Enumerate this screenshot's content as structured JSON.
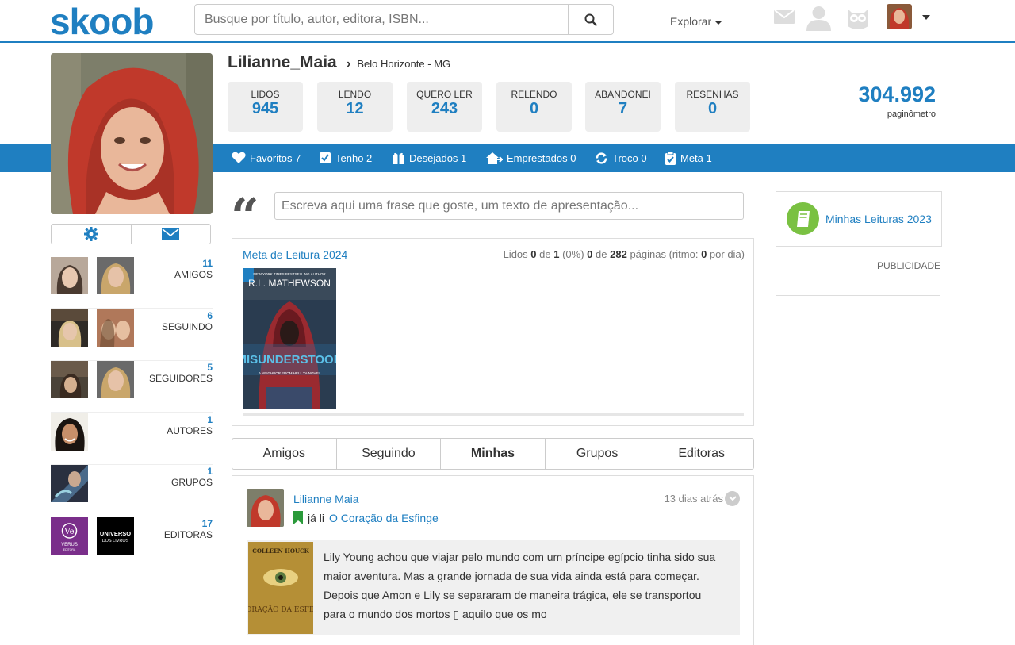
{
  "brand": {
    "logo": "skoob",
    "color": "#1f7fc1"
  },
  "search": {
    "placeholder": "Busque por título, autor, editora, ISBN..."
  },
  "nav": {
    "explorar": "Explorar"
  },
  "profile": {
    "username": "Lilianne_Maia",
    "city": "Belo Horizonte",
    "separator": "-",
    "state": "MG"
  },
  "stats": [
    {
      "label": "LIDOS",
      "value": "945"
    },
    {
      "label": "LENDO",
      "value": "12"
    },
    {
      "label": "QUERO LER",
      "value": "243"
    },
    {
      "label": "RELENDO",
      "value": "0"
    },
    {
      "label": "ABANDONEI",
      "value": "7"
    },
    {
      "label": "RESENHAS",
      "value": "0"
    }
  ],
  "paginometro": {
    "value": "304.992",
    "label": "paginômetro"
  },
  "shelves": [
    {
      "icon": "heart-icon",
      "label": "Favoritos 7"
    },
    {
      "icon": "checkbox-icon",
      "label": "Tenho 2"
    },
    {
      "icon": "gift-icon",
      "label": "Desejados 1"
    },
    {
      "icon": "house-icon",
      "label": "Emprestados 0"
    },
    {
      "icon": "exchange-icon",
      "label": "Troco 0"
    },
    {
      "icon": "clipboard-icon",
      "label": "Meta 1"
    }
  ],
  "social": [
    {
      "count": "11",
      "label": "AMIGOS"
    },
    {
      "count": "6",
      "label": "SEGUINDO"
    },
    {
      "count": "5",
      "label": "SEGUIDORES"
    },
    {
      "count": "1",
      "label": "AUTORES"
    },
    {
      "count": "1",
      "label": "GRUPOS"
    },
    {
      "count": "17",
      "label": "EDITORAS"
    }
  ],
  "quote": {
    "placeholder": "Escreva aqui uma frase que goste, um texto de apresentação..."
  },
  "meta": {
    "title": "Meta de Leitura 2024",
    "lidos_label": "Lidos",
    "read": "0",
    "de1": "de",
    "goal": "1",
    "percent": "(0%)",
    "pages_read": "0",
    "de2": "de",
    "pages_total": "282",
    "paginas_label": "páginas (ritmo:",
    "pace": "0",
    "pace_suffix": "por dia)",
    "progress": 0,
    "book": {
      "series": "NEW YORK TIMES BESTSELLING AUTHOR",
      "author": "R.L. MATHEWSON",
      "title": "MISUNDERSTOOD",
      "subtitle": "A NEIGHBOR FROM HELL YA NOVEL"
    }
  },
  "tabs": [
    {
      "label": "Amigos",
      "active": false
    },
    {
      "label": "Seguindo",
      "active": false
    },
    {
      "label": "Minhas",
      "active": true
    },
    {
      "label": "Grupos",
      "active": false
    },
    {
      "label": "Editoras",
      "active": false
    }
  ],
  "feed": {
    "user": "Lilianne Maia",
    "time": "13 dias atrás",
    "action": "já li",
    "book": "O Coração da Esfinge",
    "cover": {
      "author": "COLLEEN HOUCK",
      "title": "O CORAÇÃO DA ESFINGE"
    },
    "synopsis": "Lily Young achou que viajar pelo mundo com um príncipe egípcio tinha sido sua maior aventura. Mas a grande jornada de sua vida ainda está para começar. Depois que Amon e Lily se separaram de maneira trágica, ele se transportou para o mundo dos mortos ▯ aquilo que os mo"
  },
  "sidebar_right": {
    "leituras": "Minhas Leituras 2023",
    "publicidade": "PUBLICIDADE"
  },
  "publishers": {
    "verus_mark": "Ve",
    "verus_name": "VERUS",
    "verus_sub": "EDITORA",
    "universo_line1": "UNIVERSO",
    "universo_line2": "DOS LIVROS"
  }
}
